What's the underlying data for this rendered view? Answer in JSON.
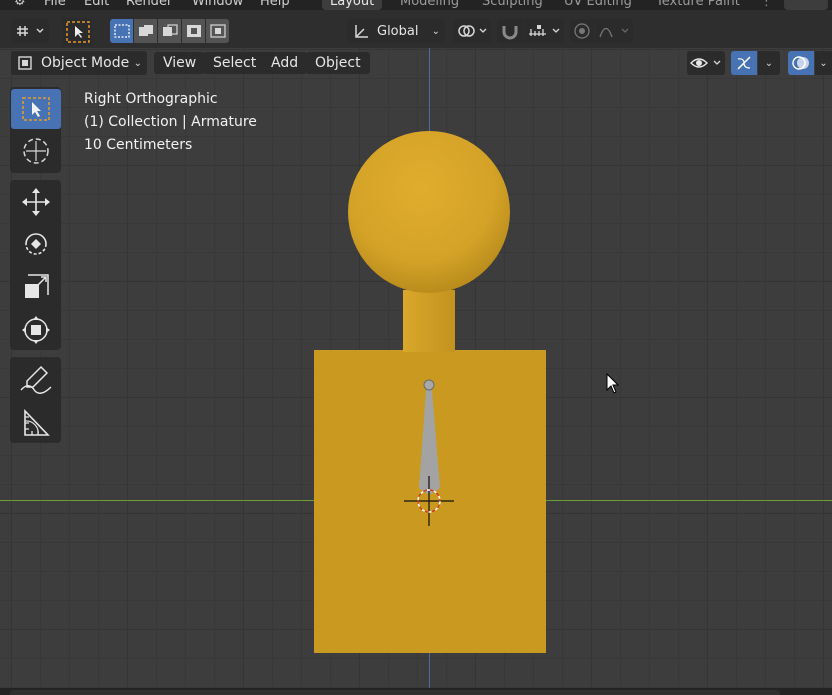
{
  "top_menu": {
    "items": [
      "File",
      "Edit",
      "Render",
      "Window",
      "Help"
    ],
    "workspace_tabs": [
      {
        "label": "Layout",
        "active": true
      },
      {
        "label": "Modeling",
        "active": false
      },
      {
        "label": "Sculpting",
        "active": false
      },
      {
        "label": "UV Editing",
        "active": false
      },
      {
        "label": "Texture Paint",
        "active": false
      }
    ]
  },
  "header": {
    "editor_type_icon": "viewport-icon",
    "transform_orientation": "Global",
    "accent": "#4772b3"
  },
  "viewport_header": {
    "mode": "Object Mode",
    "menus": [
      "View",
      "Select",
      "Add",
      "Object"
    ]
  },
  "overlay_text": {
    "view_name": "Right Orthographic",
    "collection": "(1) Collection | Armature",
    "scale": "10 Centimeters"
  },
  "toolbar": {
    "tools": [
      "select-box-icon",
      "cursor-icon",
      "move-icon",
      "rotate-icon",
      "scale-icon",
      "transform-icon",
      "annotate-icon",
      "measure-icon"
    ],
    "active": "select-box-icon"
  },
  "scene": {
    "mesh_color": "#c99a1f",
    "bone_color": "#a3a3a3"
  }
}
